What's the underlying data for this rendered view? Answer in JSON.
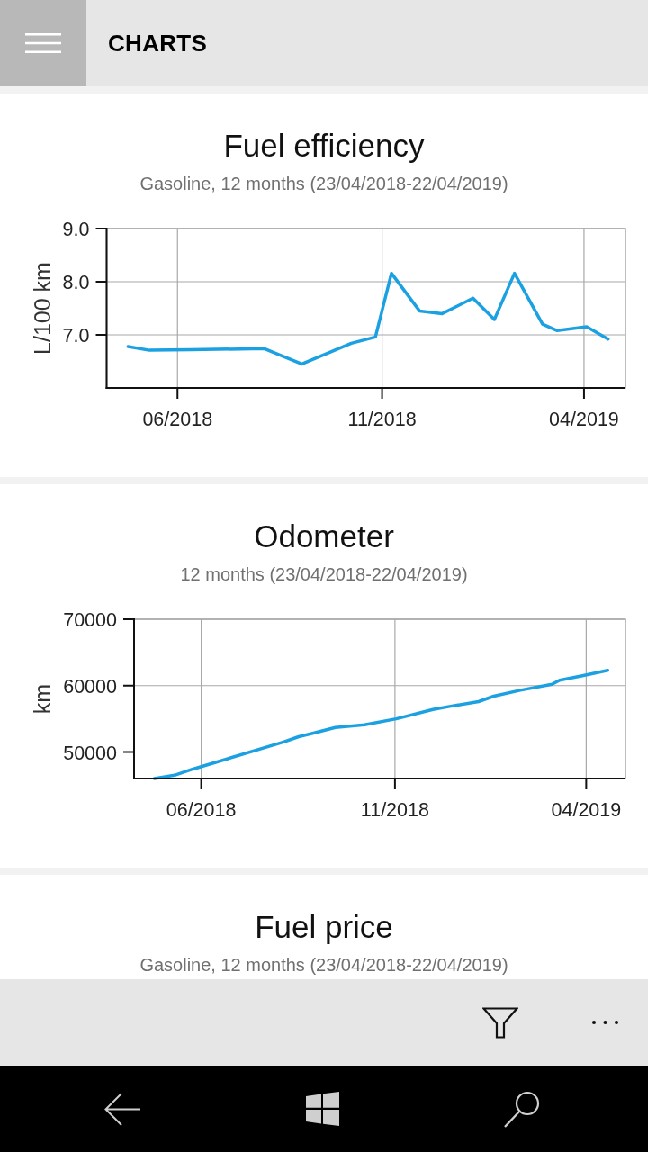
{
  "app_bar": {
    "title": "CHARTS"
  },
  "charts": [
    {
      "title": "Fuel efficiency",
      "subtitle": "Gasoline, 12 months (23/04/2018-22/04/2019)",
      "chart_data": {
        "type": "line",
        "ylabel": "L/100 km",
        "x": [
          "2018-04-25",
          "2018-05-11",
          "2018-06-11",
          "2018-08-05",
          "2018-09-02",
          "2018-10-09",
          "2018-10-27",
          "2018-11-08",
          "2018-11-29",
          "2018-12-16",
          "2019-01-08",
          "2019-01-24",
          "2019-02-08",
          "2019-03-01",
          "2019-03-12",
          "2019-04-03",
          "2019-04-19"
        ],
        "series": [
          {
            "color": "#1ba1e2",
            "values": [
              6.78,
              6.71,
              6.72,
              6.74,
              6.45,
              6.84,
              6.96,
              8.16,
              7.45,
              7.4,
              7.69,
              7.29,
              8.16,
              7.2,
              7.08,
              7.15,
              6.92
            ]
          }
        ],
        "xlim": [
          "2018-04-09",
          "2019-05-02"
        ],
        "ylim": [
          6,
          9
        ],
        "xticks": [
          {
            "value": "2018-06-01",
            "label": "06/2018"
          },
          {
            "value": "2018-11-01",
            "label": "11/2018"
          },
          {
            "value": "2019-04-01",
            "label": "04/2019"
          }
        ],
        "yticks": [
          {
            "value": 7,
            "label": "7.0"
          },
          {
            "value": 8,
            "label": "8.0"
          },
          {
            "value": 9,
            "label": "9.0"
          }
        ],
        "grid": true
      }
    },
    {
      "title": "Odometer",
      "subtitle": "12 months (23/04/2018-22/04/2019)",
      "chart_data": {
        "type": "line",
        "ylabel": "km",
        "x": [
          "2018-04-25",
          "2018-05-11",
          "2018-05-25",
          "2018-08-05",
          "2018-08-17",
          "2018-08-28",
          "2018-09-15",
          "2018-10-08",
          "2018-11-02",
          "2018-12-01",
          "2018-12-18",
          "2019-01-06",
          "2019-01-18",
          "2019-02-08",
          "2019-03-05",
          "2019-03-11",
          "2019-03-29",
          "2019-04-18"
        ],
        "series": [
          {
            "color": "#1ba1e2",
            "values": [
              46000,
              46500,
              47400,
              51500,
              52300,
              52800,
              53700,
              54100,
              55000,
              56400,
              57000,
              57600,
              58400,
              59300,
              60200,
              60800,
              61500,
              62300
            ]
          }
        ],
        "xlim": [
          "2018-04-09",
          "2019-05-02"
        ],
        "ylim": [
          46000,
          70000
        ],
        "xticks": [
          {
            "value": "2018-06-01",
            "label": "06/2018"
          },
          {
            "value": "2018-11-01",
            "label": "11/2018"
          },
          {
            "value": "2019-04-01",
            "label": "04/2019"
          }
        ],
        "yticks": [
          50000,
          60000,
          70000
        ],
        "grid": true
      }
    },
    {
      "title": "Fuel price",
      "subtitle": "Gasoline, 12 months (23/04/2018-22/04/2019)"
    }
  ]
}
